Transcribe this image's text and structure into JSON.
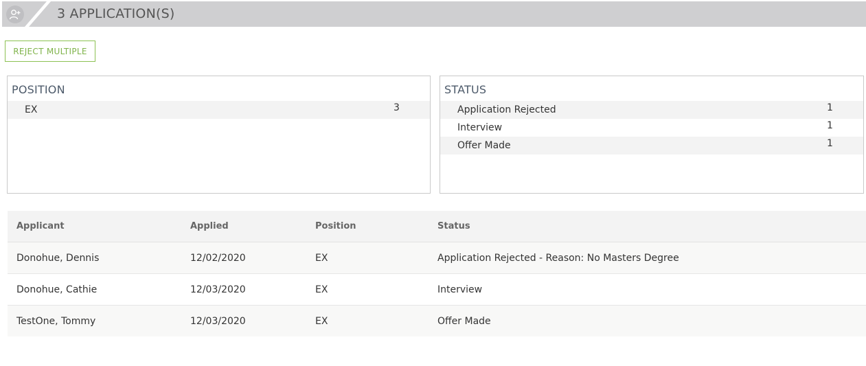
{
  "header": {
    "title": "3 APPLICATION(S)",
    "icon": "add-user-icon"
  },
  "actions": {
    "reject_multiple_label": "REJECT MULTIPLE"
  },
  "position_panel": {
    "title": "POSITION",
    "rows": [
      {
        "label": "EX",
        "count": "3"
      }
    ]
  },
  "status_panel": {
    "title": "STATUS",
    "rows": [
      {
        "label": "Application Rejected",
        "count": "1"
      },
      {
        "label": "Interview",
        "count": "1"
      },
      {
        "label": "Offer Made",
        "count": "1"
      }
    ]
  },
  "table": {
    "columns": [
      "Applicant",
      "Applied",
      "Position",
      "Status"
    ],
    "rows": [
      {
        "applicant": "Donohue, Dennis",
        "applied": "12/02/2020",
        "position": "EX",
        "status": "Application Rejected - Reason: No Masters Degree"
      },
      {
        "applicant": "Donohue, Cathie",
        "applied": "12/03/2020",
        "position": "EX",
        "status": "Interview"
      },
      {
        "applicant": "TestOne, Tommy",
        "applied": "12/03/2020",
        "position": "EX",
        "status": "Offer Made"
      }
    ]
  },
  "colors": {
    "header_band": "#cfcfd1",
    "accent_green": "#8cc152",
    "panel_title": "#4d5a6a"
  }
}
